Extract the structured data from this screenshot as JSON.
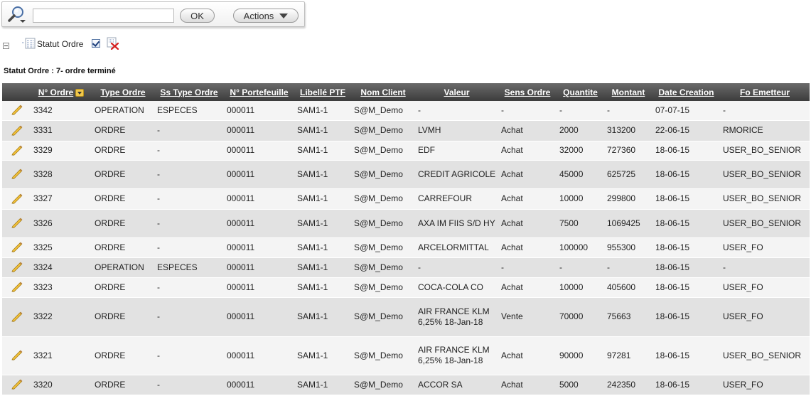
{
  "toolbar": {
    "search_value": "",
    "ok_label": "OK",
    "actions_label": "Actions"
  },
  "filter": {
    "label": "Statut Ordre",
    "checked": true
  },
  "status_title": "Statut Ordre : 7- ordre terminé",
  "table": {
    "columns": [
      "N° Ordre",
      "Type Ordre",
      "Ss Type Ordre",
      "N° Portefeuille",
      "Libellé PTF",
      "Nom Client",
      "Valeur",
      "Sens Ordre",
      "Quantite",
      "Montant",
      "Date Creation",
      "Fo Emetteur"
    ],
    "rows": [
      [
        "3342",
        "OPERATION",
        "ESPECES",
        "000011",
        "SAM1-1",
        "S@M_Demo",
        "-",
        "-",
        "-",
        "-",
        "07-07-15",
        "-"
      ],
      [
        "3331",
        "ORDRE",
        "-",
        "000011",
        "SAM1-1",
        "S@M_Demo",
        "LVMH",
        "Achat",
        "2000",
        "313200",
        "22-06-15",
        "RMORICE"
      ],
      [
        "3329",
        "ORDRE",
        "-",
        "000011",
        "SAM1-1",
        "S@M_Demo",
        "EDF",
        "Achat",
        "32000",
        "727360",
        "18-06-15",
        "USER_BO_SENIOR"
      ],
      [
        "3328",
        "ORDRE",
        "-",
        "000011",
        "SAM1-1",
        "S@M_Demo",
        "CREDIT AGRICOLE",
        "Achat",
        "45000",
        "625725",
        "18-06-15",
        "USER_BO_SENIOR"
      ],
      [
        "3327",
        "ORDRE",
        "-",
        "000011",
        "SAM1-1",
        "S@M_Demo",
        "CARREFOUR",
        "Achat",
        "10000",
        "299800",
        "18-06-15",
        "USER_BO_SENIOR"
      ],
      [
        "3326",
        "ORDRE",
        "-",
        "000011",
        "SAM1-1",
        "S@M_Demo",
        "AXA IM FIIS S/D HY",
        "Achat",
        "7500",
        "1069425",
        "18-06-15",
        "USER_BO_SENIOR"
      ],
      [
        "3325",
        "ORDRE",
        "-",
        "000011",
        "SAM1-1",
        "S@M_Demo",
        "ARCELORMITTAL",
        "Achat",
        "100000",
        "955300",
        "18-06-15",
        "USER_FO"
      ],
      [
        "3324",
        "OPERATION",
        "ESPECES",
        "000011",
        "SAM1-1",
        "S@M_Demo",
        "-",
        "-",
        "-",
        "-",
        "18-06-15",
        "-"
      ],
      [
        "3323",
        "ORDRE",
        "-",
        "000011",
        "SAM1-1",
        "S@M_Demo",
        "COCA-COLA CO",
        "Achat",
        "10000",
        "405600",
        "18-06-15",
        "USER_FO"
      ],
      [
        "3322",
        "ORDRE",
        "-",
        "000011",
        "SAM1-1",
        "S@M_Demo",
        "AIR FRANCE KLM 6,25% 18-Jan-18",
        "Vente",
        "70000",
        "75663",
        "18-06-15",
        "USER_FO"
      ],
      [
        "3321",
        "ORDRE",
        "-",
        "000011",
        "SAM1-1",
        "S@M_Demo",
        "AIR FRANCE KLM 6,25% 18-Jan-18",
        "Achat",
        "90000",
        "97281",
        "18-06-15",
        "USER_BO_SENIOR"
      ],
      [
        "3320",
        "ORDRE",
        "-",
        "000011",
        "SAM1-1",
        "S@M_Demo",
        "ACCOR SA",
        "Achat",
        "5000",
        "242350",
        "18-06-15",
        "USER_FO"
      ]
    ]
  },
  "icons": {
    "search": "search-icon",
    "filter": "filter-list-icon",
    "remove_filter": "remove-filter-icon",
    "edit": "pencil-icon"
  },
  "colors": {
    "header_dark": "#3c3c3c",
    "row_light": "#f4f4f4",
    "row_dark": "#e2e2e2",
    "sort_badge": "#f2c84b"
  }
}
